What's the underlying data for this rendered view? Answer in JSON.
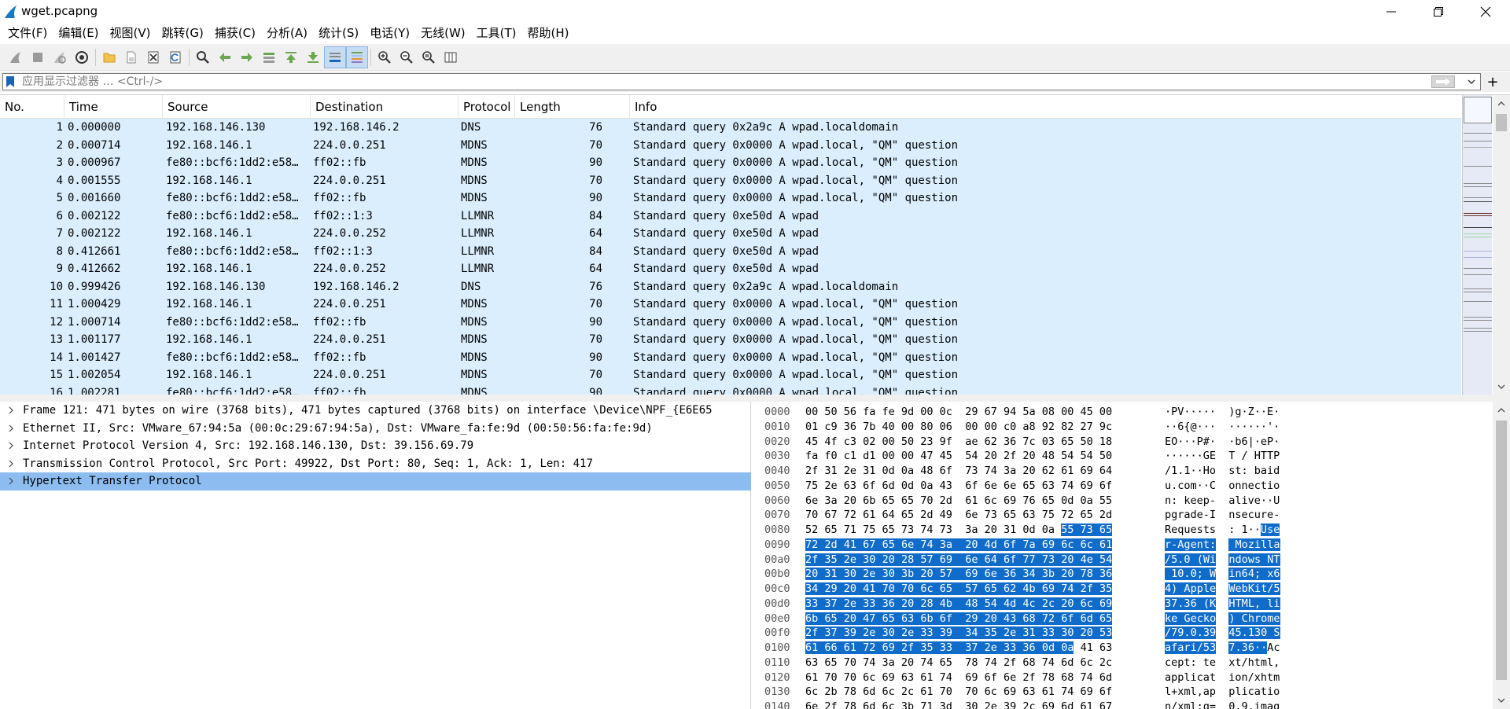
{
  "window": {
    "title": "wget.pcapng"
  },
  "menu": [
    "文件(F)",
    "编辑(E)",
    "视图(V)",
    "跳转(G)",
    "捕获(C)",
    "分析(A)",
    "统计(S)",
    "电话(Y)",
    "无线(W)",
    "工具(T)",
    "帮助(H)"
  ],
  "toolbar_icons": [
    "shark-fin-start-icon",
    "stop-icon",
    "restart-icon",
    "capture-options-icon",
    "open-file-icon",
    "save-file-icon",
    "close-file-icon",
    "reload-icon",
    "find-icon",
    "go-back-icon",
    "go-forward-icon",
    "go-to-packet-icon",
    "go-first-icon",
    "go-last-icon",
    "autoscroll-icon",
    "colorize-icon",
    "zoom-in-icon",
    "zoom-out-icon",
    "zoom-normal-icon",
    "resize-columns-icon"
  ],
  "filter": {
    "placeholder": "应用显示过滤器 … <Ctrl-/>",
    "add_label": "+"
  },
  "packet_list": {
    "columns": [
      "No.",
      "Time",
      "Source",
      "Destination",
      "Protocol",
      "Length",
      "Info"
    ],
    "rows": [
      {
        "no": "1",
        "time": "0.000000",
        "src": "192.168.146.130",
        "dst": "192.168.146.2",
        "proto": "DNS",
        "len": "76",
        "info": "Standard query 0x2a9c A wpad.localdomain"
      },
      {
        "no": "2",
        "time": "0.000714",
        "src": "192.168.146.1",
        "dst": "224.0.0.251",
        "proto": "MDNS",
        "len": "70",
        "info": "Standard query 0x0000 A wpad.local, \"QM\" question"
      },
      {
        "no": "3",
        "time": "0.000967",
        "src": "fe80::bcf6:1dd2:e58…",
        "dst": "ff02::fb",
        "proto": "MDNS",
        "len": "90",
        "info": "Standard query 0x0000 A wpad.local, \"QM\" question"
      },
      {
        "no": "4",
        "time": "0.001555",
        "src": "192.168.146.1",
        "dst": "224.0.0.251",
        "proto": "MDNS",
        "len": "70",
        "info": "Standard query 0x0000 A wpad.local, \"QM\" question"
      },
      {
        "no": "5",
        "time": "0.001660",
        "src": "fe80::bcf6:1dd2:e58…",
        "dst": "ff02::fb",
        "proto": "MDNS",
        "len": "90",
        "info": "Standard query 0x0000 A wpad.local, \"QM\" question"
      },
      {
        "no": "6",
        "time": "0.002122",
        "src": "fe80::bcf6:1dd2:e58…",
        "dst": "ff02::1:3",
        "proto": "LLMNR",
        "len": "84",
        "info": "Standard query 0xe50d A wpad"
      },
      {
        "no": "7",
        "time": "0.002122",
        "src": "192.168.146.1",
        "dst": "224.0.0.252",
        "proto": "LLMNR",
        "len": "64",
        "info": "Standard query 0xe50d A wpad"
      },
      {
        "no": "8",
        "time": "0.412661",
        "src": "fe80::bcf6:1dd2:e58…",
        "dst": "ff02::1:3",
        "proto": "LLMNR",
        "len": "84",
        "info": "Standard query 0xe50d A wpad"
      },
      {
        "no": "9",
        "time": "0.412662",
        "src": "192.168.146.1",
        "dst": "224.0.0.252",
        "proto": "LLMNR",
        "len": "64",
        "info": "Standard query 0xe50d A wpad"
      },
      {
        "no": "10",
        "time": "0.999426",
        "src": "192.168.146.130",
        "dst": "192.168.146.2",
        "proto": "DNS",
        "len": "76",
        "info": "Standard query 0x2a9c A wpad.localdomain"
      },
      {
        "no": "11",
        "time": "1.000429",
        "src": "192.168.146.1",
        "dst": "224.0.0.251",
        "proto": "MDNS",
        "len": "70",
        "info": "Standard query 0x0000 A wpad.local, \"QM\" question"
      },
      {
        "no": "12",
        "time": "1.000714",
        "src": "fe80::bcf6:1dd2:e58…",
        "dst": "ff02::fb",
        "proto": "MDNS",
        "len": "90",
        "info": "Standard query 0x0000 A wpad.local, \"QM\" question"
      },
      {
        "no": "13",
        "time": "1.001177",
        "src": "192.168.146.1",
        "dst": "224.0.0.251",
        "proto": "MDNS",
        "len": "70",
        "info": "Standard query 0x0000 A wpad.local, \"QM\" question"
      },
      {
        "no": "14",
        "time": "1.001427",
        "src": "fe80::bcf6:1dd2:e58…",
        "dst": "ff02::fb",
        "proto": "MDNS",
        "len": "90",
        "info": "Standard query 0x0000 A wpad.local, \"QM\" question"
      },
      {
        "no": "15",
        "time": "1.002054",
        "src": "192.168.146.1",
        "dst": "224.0.0.251",
        "proto": "MDNS",
        "len": "70",
        "info": "Standard query 0x0000 A wpad.local, \"QM\" question"
      },
      {
        "no": "16",
        "time": "1.002281",
        "src": "fe80::bcf6:1dd2:e58…",
        "dst": "ff02::fb",
        "proto": "MDNS",
        "len": "90",
        "info": "Standard query 0x0000 A wpad.local, \"QM\" question"
      }
    ]
  },
  "details": [
    {
      "text": "Frame 121: 471 bytes on wire (3768 bits), 471 bytes captured (3768 bits) on interface \\Device\\NPF_{E6E65",
      "selected": false
    },
    {
      "text": "Ethernet II, Src: VMware_67:94:5a (00:0c:29:67:94:5a), Dst: VMware_fa:fe:9d (00:50:56:fa:fe:9d)",
      "selected": false
    },
    {
      "text": "Internet Protocol Version 4, Src: 192.168.146.130, Dst: 39.156.69.79",
      "selected": false
    },
    {
      "text": "Transmission Control Protocol, Src Port: 49922, Dst Port: 80, Seq: 1, Ack: 1, Len: 417",
      "selected": false
    },
    {
      "text": "Hypertext Transfer Protocol",
      "selected": true
    }
  ],
  "bytes": [
    {
      "off": "0000",
      "hex": "00 50 56 fa fe 9d 00 0c  29 67 94 5a 08 00 45 00",
      "ascii": "·PV·····  )g·Z··E·",
      "hl_start": -1,
      "hl_end": -1
    },
    {
      "off": "0010",
      "hex": "01 c9 36 7b 40 00 80 06  00 00 c0 a8 92 82 27 9c",
      "ascii": "··6{@···  ······'·",
      "hl_start": -1,
      "hl_end": -1
    },
    {
      "off": "0020",
      "hex": "45 4f c3 02 00 50 23 9f  ae 62 36 7c 03 65 50 18",
      "ascii": "EO···P#·  ·b6|·eP·",
      "hl_start": -1,
      "hl_end": -1
    },
    {
      "off": "0030",
      "hex": "fa f0 c1 d1 00 00 47 45  54 20 2f 20 48 54 54 50",
      "ascii": "······GE  T / HTTP",
      "hl_start": -1,
      "hl_end": -1
    },
    {
      "off": "0040",
      "hex": "2f 31 2e 31 0d 0a 48 6f  73 74 3a 20 62 61 69 64",
      "ascii": "/1.1··Ho  st: baid",
      "hl_start": -1,
      "hl_end": -1
    },
    {
      "off": "0050",
      "hex": "75 2e 63 6f 6d 0d 0a 43  6f 6e 6e 65 63 74 69 6f",
      "ascii": "u.com··C  onnectio",
      "hl_start": -1,
      "hl_end": -1
    },
    {
      "off": "0060",
      "hex": "6e 3a 20 6b 65 65 70 2d  61 6c 69 76 65 0d 0a 55",
      "ascii": "n: keep-  alive··U",
      "hl_start": -1,
      "hl_end": -1
    },
    {
      "off": "0070",
      "hex": "70 67 72 61 64 65 2d 49  6e 73 65 63 75 72 65 2d",
      "ascii": "pgrade-I  nsecure-",
      "hl_start": -1,
      "hl_end": -1
    },
    {
      "off": "0080",
      "hex": "52 65 71 75 65 73 74 73  3a 20 31 0d 0a 55 73 65",
      "ascii": "Requests  : 1··Use",
      "hl_start": 13,
      "hl_end": 16
    },
    {
      "off": "0090",
      "hex": "72 2d 41 67 65 6e 74 3a  20 4d 6f 7a 69 6c 6c 61",
      "ascii": "r-Agent:   Mozilla",
      "hl_start": 0,
      "hl_end": 16
    },
    {
      "off": "00a0",
      "hex": "2f 35 2e 30 20 28 57 69  6e 64 6f 77 73 20 4e 54",
      "ascii": "/5.0 (Wi  ndows NT",
      "hl_start": 0,
      "hl_end": 16
    },
    {
      "off": "00b0",
      "hex": "20 31 30 2e 30 3b 20 57  69 6e 36 34 3b 20 78 36",
      "ascii": " 10.0; W  in64; x6",
      "hl_start": 0,
      "hl_end": 16
    },
    {
      "off": "00c0",
      "hex": "34 29 20 41 70 70 6c 65  57 65 62 4b 69 74 2f 35",
      "ascii": "4) Apple  WebKit/5",
      "hl_start": 0,
      "hl_end": 16
    },
    {
      "off": "00d0",
      "hex": "33 37 2e 33 36 20 28 4b  48 54 4d 4c 2c 20 6c 69",
      "ascii": "37.36 (K  HTML, li",
      "hl_start": 0,
      "hl_end": 16
    },
    {
      "off": "00e0",
      "hex": "6b 65 20 47 65 63 6b 6f  29 20 43 68 72 6f 6d 65",
      "ascii": "ke Gecko  ) Chrome",
      "hl_start": 0,
      "hl_end": 16
    },
    {
      "off": "00f0",
      "hex": "2f 37 39 2e 30 2e 33 39  34 35 2e 31 33 30 20 53",
      "ascii": "/79.0.39  45.130 S",
      "hl_start": 0,
      "hl_end": 16
    },
    {
      "off": "0100",
      "hex": "61 66 61 72 69 2f 35 33  37 2e 33 36 0d 0a 41 63",
      "ascii": "afari/53  7.36··Ac",
      "hl_start": 0,
      "hl_end": 14
    },
    {
      "off": "0110",
      "hex": "63 65 70 74 3a 20 74 65  78 74 2f 68 74 6d 6c 2c",
      "ascii": "cept: te  xt/html,",
      "hl_start": -1,
      "hl_end": -1
    },
    {
      "off": "0120",
      "hex": "61 70 70 6c 69 63 61 74  69 6f 6e 2f 78 68 74 6d",
      "ascii": "applicat  ion/xhtm",
      "hl_start": -1,
      "hl_end": -1
    },
    {
      "off": "0130",
      "hex": "6c 2b 78 6d 6c 2c 61 70  70 6c 69 63 61 74 69 6f",
      "ascii": "l+xml,ap  plicatio",
      "hl_start": -1,
      "hl_end": -1
    },
    {
      "off": "0140",
      "hex": "6e 2f 78 6d 6c 3b 71 3d  30 2e 39 2c 69 6d 61 67",
      "ascii": "n/xml;q=  0.9,imag",
      "hl_start": -1,
      "hl_end": -1
    }
  ],
  "colors": {
    "row_bg": "#daeefe",
    "selected_detail": "#8cbcf0",
    "byte_highlight": "#0f6ccb"
  }
}
